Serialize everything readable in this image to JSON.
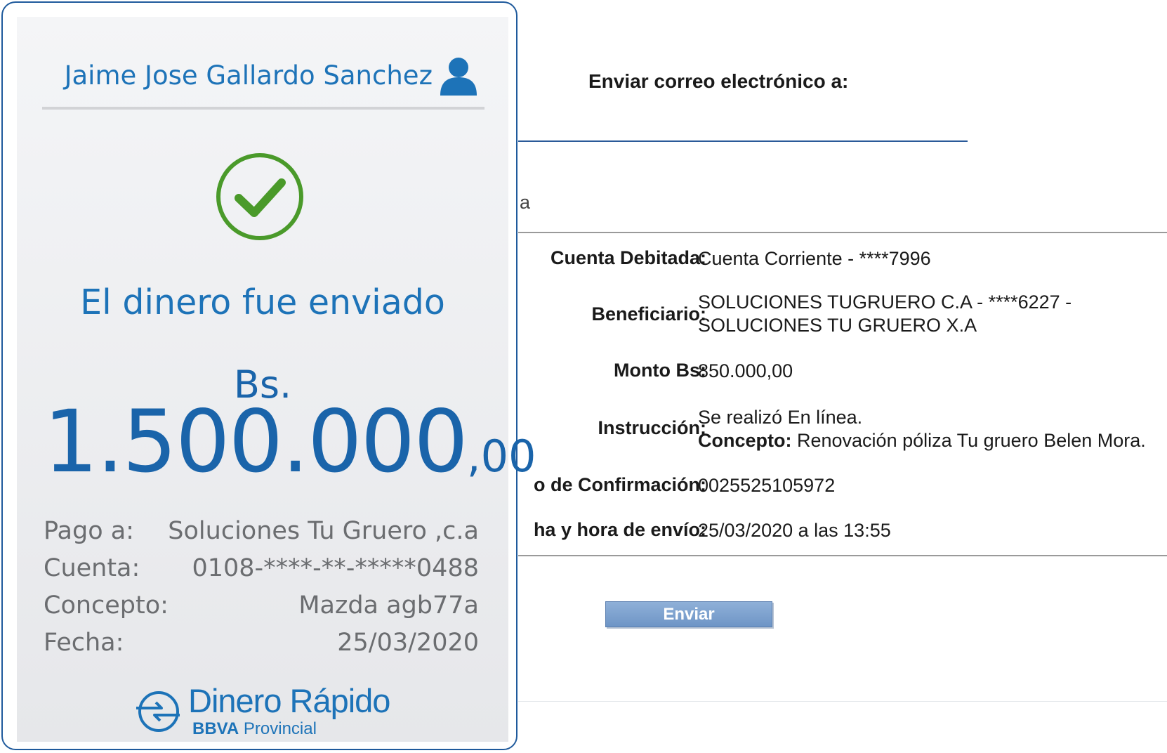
{
  "receipt": {
    "user_name": "Jaime Jose Gallardo Sanchez",
    "status_title": "El dinero fue enviado",
    "currency": "Bs.",
    "amount_main": "1.500.000",
    "amount_cents": ",00",
    "details": {
      "pago_label": "Pago a:",
      "pago_value": "Soluciones Tu Gruero ,c.a",
      "cuenta_label": "Cuenta:",
      "cuenta_value": "0108-****-**-*****0488",
      "concepto_label": "Concepto:",
      "concepto_value": "Mazda agb77a",
      "fecha_label": "Fecha:",
      "fecha_value": "25/03/2020"
    },
    "brand": {
      "name": "Dinero Rápido",
      "bbva": "BBVA",
      "provincial": "Provincial"
    },
    "colors": {
      "accent_blue": "#1d73b8",
      "check_green": "#4a9a2a"
    },
    "icons": [
      "user-icon",
      "check-circle-icon",
      "dinero-rapido-logo-icon"
    ]
  },
  "email_panel": {
    "email_label": "Enviar correo electrónico a:",
    "email_value": "",
    "section_fragment": "a",
    "rows": {
      "cuenta_debitada_label": "Cuenta Debitada:",
      "cuenta_debitada_value": "Cuenta Corriente - ****7996",
      "beneficiario_label": "Beneficiario:",
      "beneficiario_line1": "SOLUCIONES TUGRUERO C.A - ****6227 -",
      "beneficiario_line2": "SOLUCIONES TU GRUERO X.A",
      "monto_label": "Monto Bs:",
      "monto_value": "850.000,00",
      "instruccion_label": "Instrucción:",
      "instruccion_line1": "Se realizó En línea.",
      "concepto_label": "Concepto:",
      "concepto_value": " Renovación póliza Tu gruero Belen Mora.",
      "confirmacion_label": "o de Confirmación:",
      "confirmacion_value": "0025525105972",
      "fecha_label": "ha y hora de envío:",
      "fecha_value": "25/03/2020 a las 13:55"
    },
    "send_button": "Enviar"
  }
}
